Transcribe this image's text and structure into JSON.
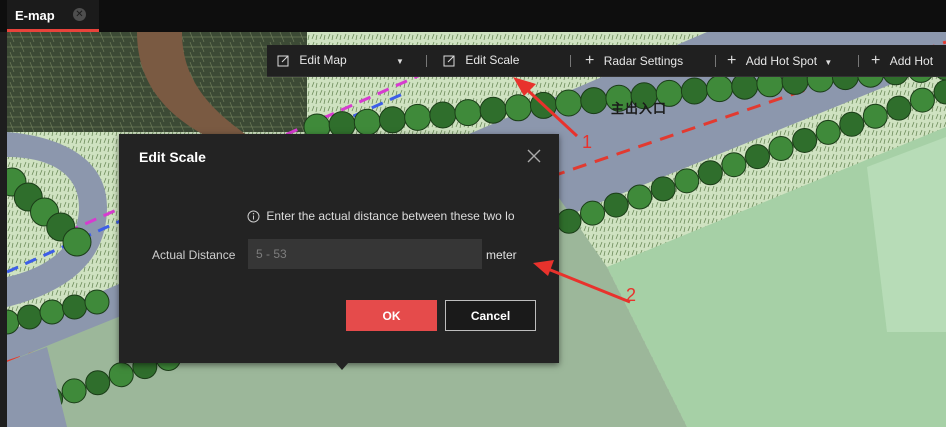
{
  "tab": {
    "title": "E-map",
    "close_icon": "close-circle-icon"
  },
  "map": {
    "location_label": "主出入口"
  },
  "toolbar": {
    "items": [
      {
        "label": "Edit Map",
        "icon": "edit-icon",
        "has_dropdown": true
      },
      {
        "label": "Edit Scale",
        "icon": "edit-icon"
      },
      {
        "label": "Radar Settings",
        "icon": "plus-icon"
      },
      {
        "label": "Add Hot Spot",
        "icon": "plus-icon",
        "has_dropdown": true
      },
      {
        "label": "Add Hot",
        "icon": "plus-icon"
      }
    ]
  },
  "dialog": {
    "title": "Edit Scale",
    "info_text": "Enter the actual distance between these two lo",
    "distance_label": "Actual Distance",
    "distance_placeholder": "5 - 53",
    "distance_value": "",
    "unit": "meter",
    "ok_label": "OK",
    "cancel_label": "Cancel"
  },
  "annotations": {
    "marker_1": "1",
    "marker_2": "2"
  },
  "colors": {
    "accent_red": "#e54b4b",
    "annotation_red": "#e8322c",
    "toolbar_bg": "#202020",
    "dialog_bg": "#232323",
    "road": "#8c97ad",
    "lawn": "#a6d0a6",
    "tree": "#2f6e2c"
  }
}
